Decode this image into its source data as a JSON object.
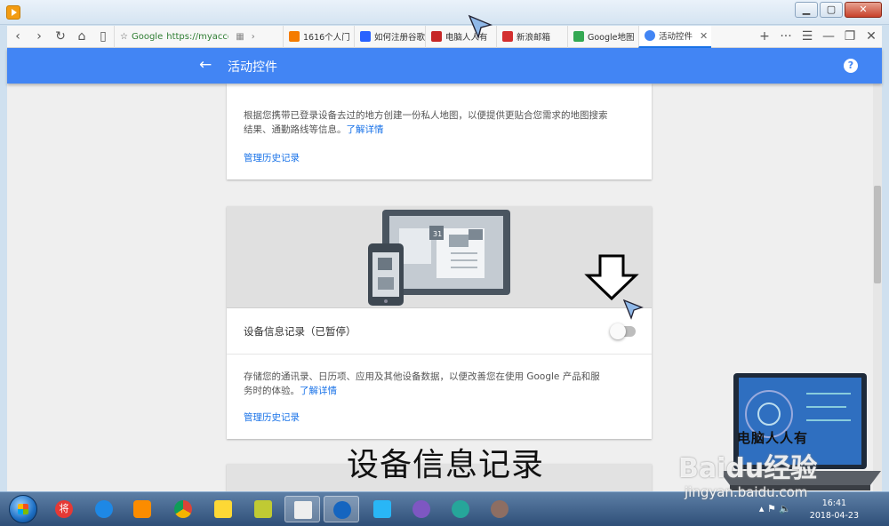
{
  "window": {
    "controls": {
      "minimize": "▁",
      "maximize": "▢",
      "close": "✕"
    }
  },
  "toolbar": {
    "back": "‹",
    "forward": "›",
    "reload": "↻",
    "home": "⌂",
    "reader": "▯",
    "star": "☆",
    "url_host": "Google",
    "url": "https://myaccoun",
    "tabs": [
      {
        "label": "1616个人门",
        "favicon_color": "#f57c00"
      },
      {
        "label": "如何注册谷歌",
        "favicon_color": "#2962ff"
      },
      {
        "label": "电脑人人有",
        "favicon_color": "#c62828"
      },
      {
        "label": "新浪邮箱",
        "favicon_color": "#d32f2f"
      },
      {
        "label": "Google地图",
        "favicon_color": "#34a853"
      },
      {
        "label": "活动控件",
        "favicon_color": "#4285f4"
      }
    ],
    "tab_close": "✕",
    "new_tab": "+",
    "more": "···",
    "menu": "☰",
    "min": "—",
    "restore": "❐",
    "close": "✕"
  },
  "header": {
    "back_icon": "←",
    "title": "活动控件",
    "help": "?"
  },
  "cards": {
    "location": {
      "description": "根据您携带已登录设备去过的地方创建一份私人地图，以便提供更贴合您需求的地图搜索结果、通勤路线等信息。",
      "learn_more": "了解详情",
      "manage": "管理历史记录"
    },
    "device": {
      "title": "设备信息记录（已暂停）",
      "toggle_on": false,
      "description": "存储您的通讯录、日历项、应用及其他设备数据，以便改善您在使用 Google 产品和服务时的体验。",
      "learn_more": "了解详情",
      "manage": "管理历史记录",
      "calendar_day": "31"
    }
  },
  "overlay": {
    "caption": "设备信息记录",
    "laptop_text": "电脑人人有",
    "baidu_watermark": "Baidu经验",
    "jingyan_url": "jingyan.baidu.com"
  },
  "taskbar": {
    "time": "16:41",
    "date": "2018-04-23",
    "jiang_label": "将",
    "apps": [
      {
        "name": "jiang",
        "color": "#e53935"
      },
      {
        "name": "ie",
        "color": "#1e88e5"
      },
      {
        "name": "media",
        "color": "#fb8c00"
      },
      {
        "name": "chrome",
        "color": "#43a047"
      },
      {
        "name": "folder",
        "color": "#fdd835"
      },
      {
        "name": "notes",
        "color": "#c0ca33"
      },
      {
        "name": "doc",
        "color": "#eeeeee"
      },
      {
        "name": "browser",
        "color": "#1565c0"
      },
      {
        "name": "remote",
        "color": "#29b6f6"
      },
      {
        "name": "pinwheel",
        "color": "#7e57c2"
      },
      {
        "name": "headset",
        "color": "#26a69a"
      },
      {
        "name": "paint",
        "color": "#8d6e63"
      }
    ]
  }
}
